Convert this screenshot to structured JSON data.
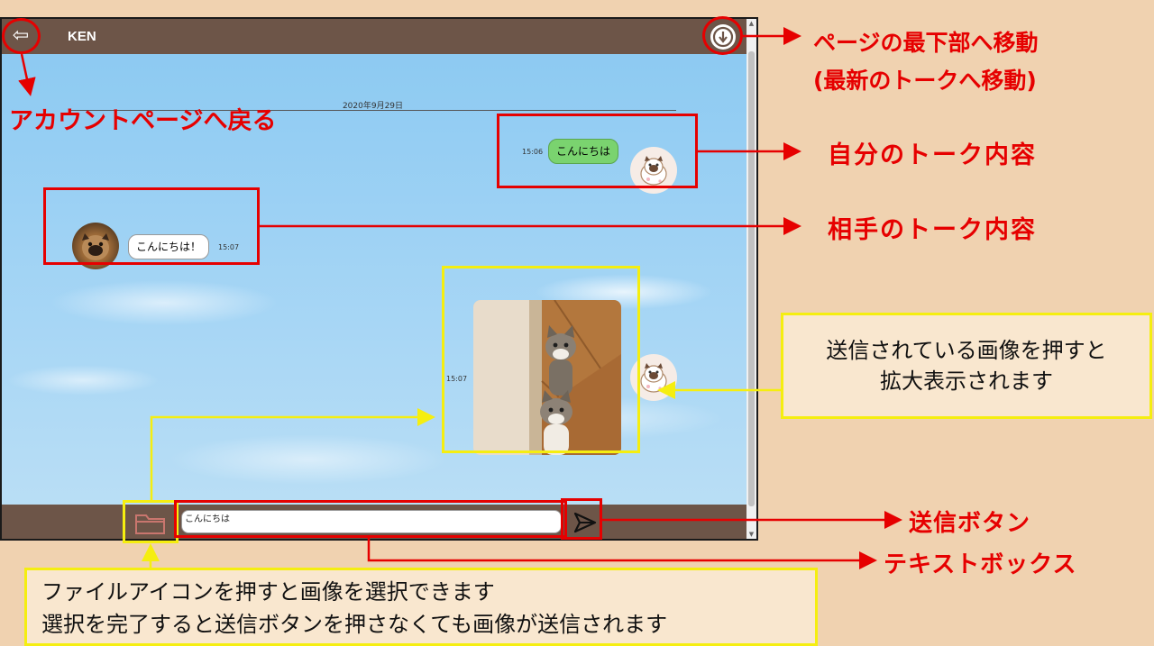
{
  "app": {
    "title": "KEN",
    "back_icon": "back-arrow-icon",
    "scroll_icon": "arrow-down-circle-icon"
  },
  "chat": {
    "date_divider": "2020年9月29日",
    "messages": [
      {
        "from": "me",
        "time": "15:06",
        "text": "こんにちは"
      },
      {
        "from": "partner",
        "time": "15:07",
        "text": "こんにちは！"
      },
      {
        "from": "me",
        "time": "15:07",
        "type": "image"
      }
    ]
  },
  "input": {
    "value": "こんにちは",
    "file_icon": "folder-icon",
    "send_icon": "send-arrow-icon"
  },
  "annotations": {
    "scroll_bottom": "ページの最下部へ移動",
    "scroll_bottom_sub": "(最新のトークへ移動)",
    "back": "アカウントページへ戻る",
    "my_message": "自分のトーク内容",
    "their_message": "相手のトーク内容",
    "image_note_line1": "送信されている画像を押すと",
    "image_note_line2": "拡大表示されます",
    "send_button": "送信ボタン",
    "text_box": "テキストボックス",
    "file_note_line1": "ファイルアイコンを押すと画像を選択できます",
    "file_note_line2": "選択を完了すると送信ボタンを押さなくても画像が送信されます"
  },
  "colors": {
    "annotation_red": "#e60000",
    "annotation_yellow": "#f5ee10",
    "header_brown": "#6d5548",
    "my_bubble_green": "#7ad36f",
    "background_beige": "#f0d2b0"
  }
}
